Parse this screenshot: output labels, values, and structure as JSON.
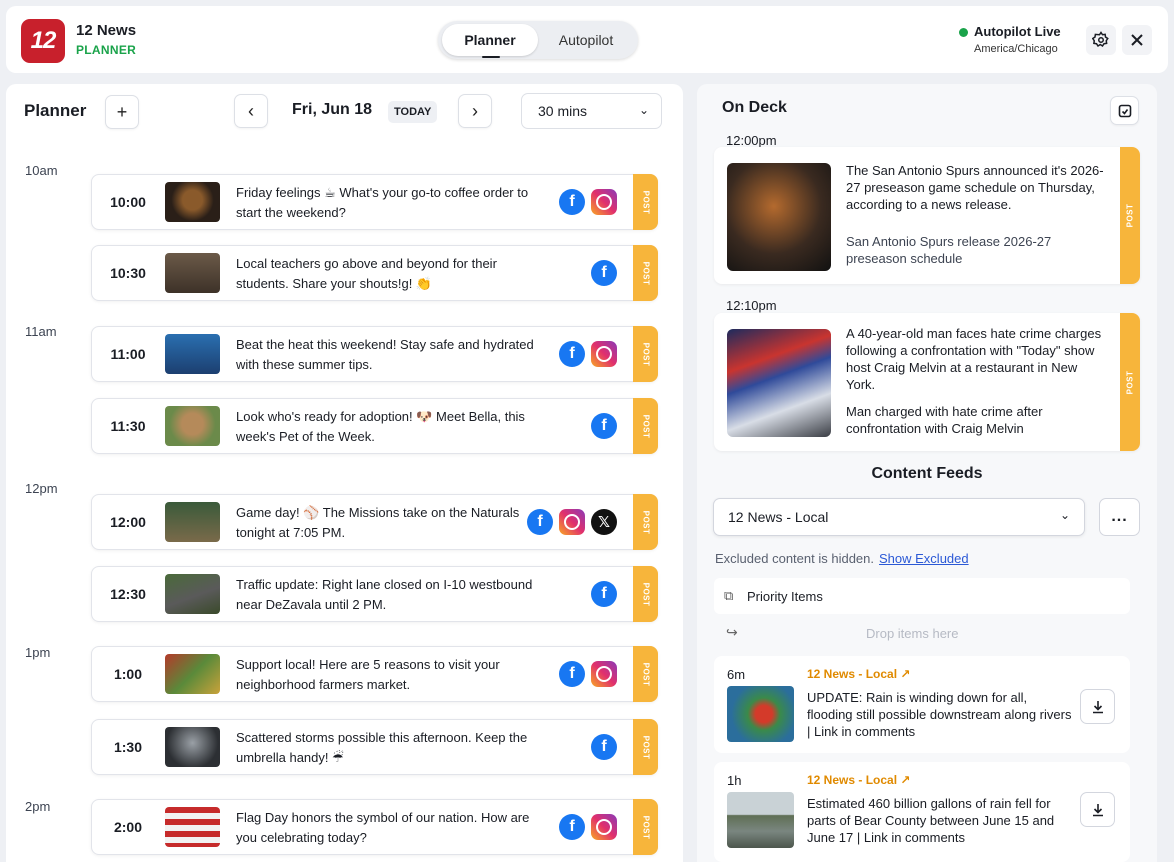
{
  "header": {
    "logo_text": "12",
    "brand_title": "12 News",
    "brand_sub": "PLANNER",
    "mode_tabs": [
      "Planner",
      "Autopilot"
    ],
    "status_label": "Autopilot Live",
    "timezone": "America/Chicago",
    "settings_icon": "gear-icon",
    "close_icon": "close-icon"
  },
  "planner": {
    "title": "Planner",
    "add_icon": "+",
    "prev_icon": "‹",
    "next_icon": "›",
    "date": "Fri, Jun 18",
    "today": "TODAY",
    "interval": "30 mins",
    "hours": [
      "10am",
      "11am",
      "12pm",
      "1pm",
      "2pm"
    ],
    "post_label": "POST",
    "slots": [
      {
        "time": "10:00",
        "text": "Friday feelings ☕ What's your go-to coffee order to start the weekend?",
        "platforms": [
          "facebook",
          "instagram"
        ]
      },
      {
        "time": "10:30",
        "text": "Local teachers go above and beyond for their students. Share your shouts!g! 👏",
        "platforms": [
          "facebook"
        ]
      },
      {
        "time": "11:00",
        "text": "Beat the heat this weekend! Stay safe and hydrated with these summer tips.",
        "platforms": [
          "facebook",
          "instagram"
        ]
      },
      {
        "time": "11:30",
        "text": "Look who's ready for adoption! 🐶 Meet Bella, this week's Pet of the Week.",
        "platforms": [
          "facebook"
        ]
      },
      {
        "time": "12:00",
        "text": "Game day! ⚾ The Missions take on the Naturals tonight at 7:05 PM.",
        "platforms": [
          "facebook",
          "instagram",
          "x"
        ]
      },
      {
        "time": "12:30",
        "text": "Traffic update: Right lane closed on I-10 westbound near DeZavala until 2 PM.",
        "platforms": [
          "facebook"
        ]
      },
      {
        "time": "1:00",
        "text": "Support local! Here are 5 reasons to visit your neighborhood farmers market.",
        "platforms": [
          "facebook",
          "instagram"
        ]
      },
      {
        "time": "1:30",
        "text": "Scattered storms possible this afternoon. Keep the umbrella handy! ☔",
        "platforms": [
          "facebook"
        ]
      },
      {
        "time": "2:00",
        "text": "Flag Day honors the symbol of our nation. How are you celebrating today?",
        "platforms": [
          "facebook",
          "instagram"
        ]
      }
    ]
  },
  "on_deck": {
    "title": "On Deck",
    "post_label": "POST",
    "items": [
      {
        "time": "12:00pm",
        "text": "The San Antonio Spurs announced it's 2026-27 preseason game schedule on Thursday, according to a news release.",
        "headline": "San Antonio Spurs release 2026-27 preseason schedule"
      },
      {
        "time": "12:10pm",
        "text": "A 40-year-old man faces hate crime charges following a confrontation with \"Today\" show host Craig Melvin at a restaurant in New York.",
        "headline": "Man charged with hate crime after confrontation with Craig Melvin"
      }
    ]
  },
  "feeds": {
    "title": "Content Feeds",
    "selected": "12 News - Local",
    "more_label": "...",
    "excluded_text": "Excluded content is hidden.",
    "show_excluded": "Show Excluded",
    "priority_label": "Priority Items",
    "drop_label": "Drop items here",
    "items": [
      {
        "age": "6m",
        "source": "12 News - Local",
        "text": "UPDATE: Rain is winding down for all, flooding still possible downstream along rivers | Link in comments"
      },
      {
        "age": "1h",
        "source": "12 News - Local",
        "text": "Estimated 460 billion gallons of rain fell for parts of Bear County between June 15 and June 17 | Link in comments"
      }
    ]
  },
  "colors": {
    "brand_red": "#c8202c",
    "accent_green": "#1aa34a",
    "post_orange": "#f7b53b",
    "link_blue": "#2b59d6",
    "source_orange": "#e08a00"
  }
}
